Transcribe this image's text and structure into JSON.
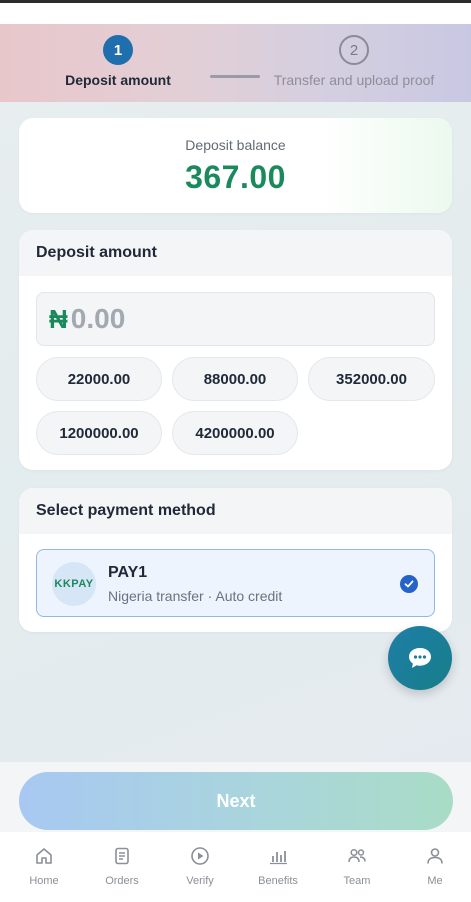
{
  "stepper": {
    "step1": {
      "number": "1",
      "label": "Deposit amount"
    },
    "step2": {
      "number": "2",
      "label": "Transfer and upload proof"
    }
  },
  "balance": {
    "label": "Deposit balance",
    "value": "367.00"
  },
  "deposit": {
    "title": "Deposit amount",
    "currency_symbol": "₦",
    "input_placeholder": "0.00",
    "input_value": "",
    "presets": [
      "22000.00",
      "88000.00",
      "352000.00",
      "1200000.00",
      "4200000.00"
    ]
  },
  "payment": {
    "title": "Select payment method",
    "method": {
      "logo_text": "KKPAY",
      "name": "PAY1",
      "description": "Nigeria transfer · Auto credit",
      "selected": true
    }
  },
  "actions": {
    "next_label": "Next"
  },
  "nav": [
    {
      "label": "Home",
      "icon": "home-icon"
    },
    {
      "label": "Orders",
      "icon": "orders-icon"
    },
    {
      "label": "Verify",
      "icon": "play-icon"
    },
    {
      "label": "Benefits",
      "icon": "chart-icon"
    },
    {
      "label": "Team",
      "icon": "team-icon"
    },
    {
      "label": "Me",
      "icon": "user-icon"
    }
  ],
  "colors": {
    "accent_green": "#1a8a5c",
    "step_active": "#1f6fae",
    "select_blue": "#2563c8"
  }
}
